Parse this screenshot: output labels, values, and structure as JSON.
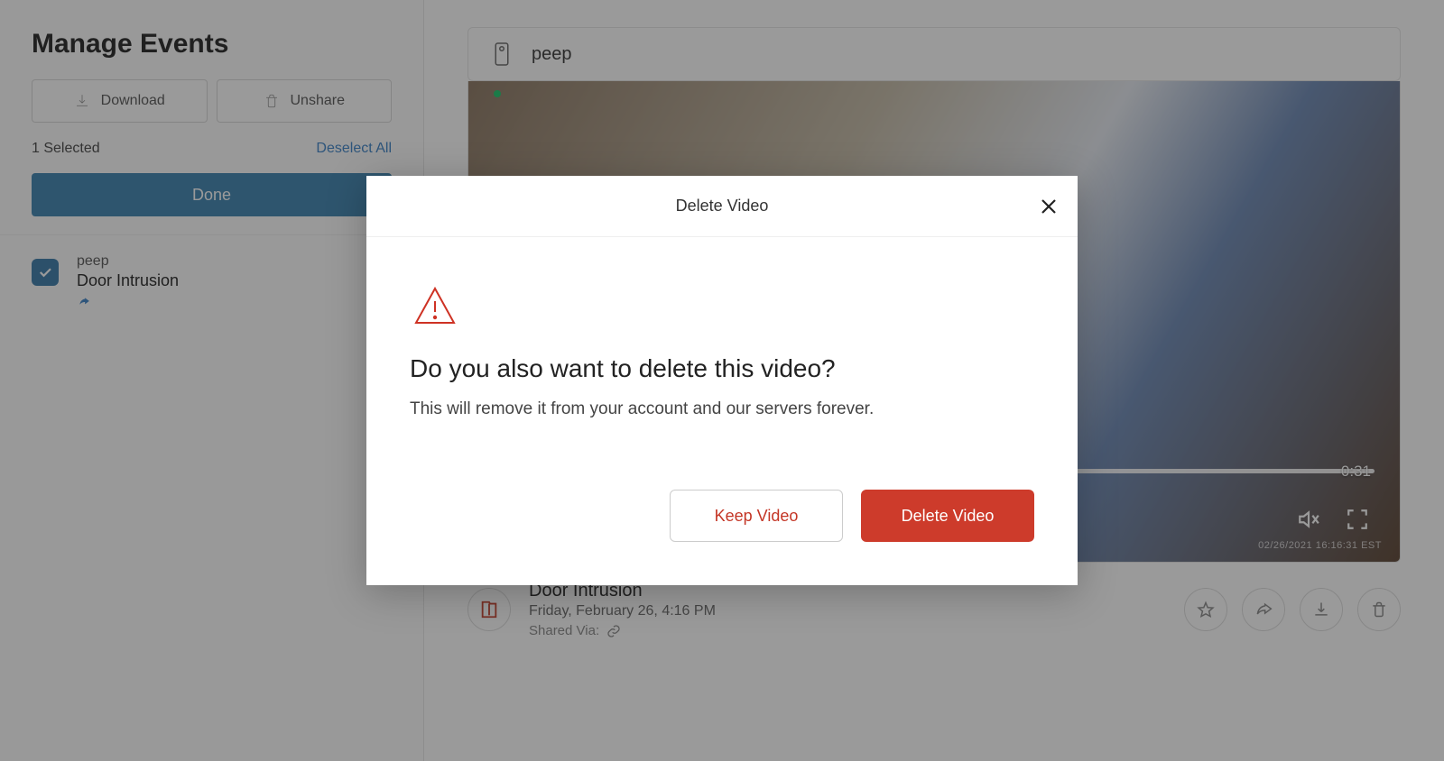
{
  "sidebar": {
    "title": "Manage Events",
    "download_label": "Download",
    "unshare_label": "Unshare",
    "selected_text": "1 Selected",
    "deselect_label": "Deselect All",
    "done_label": "Done"
  },
  "events": [
    {
      "camera": "peep",
      "name": "Door Intrusion"
    }
  ],
  "detail": {
    "device_name": "peep",
    "duration": "0:31",
    "timestamp_overlay": "02/26/2021 16:16:31 EST",
    "title": "Door Intrusion",
    "date": "Friday, February 26, 4:16 PM",
    "shared_label": "Shared Via:"
  },
  "modal": {
    "title": "Delete Video",
    "heading": "Do you also want to delete this video?",
    "body": "This will remove it from your account and our servers forever.",
    "keep_label": "Keep Video",
    "delete_label": "Delete Video"
  }
}
